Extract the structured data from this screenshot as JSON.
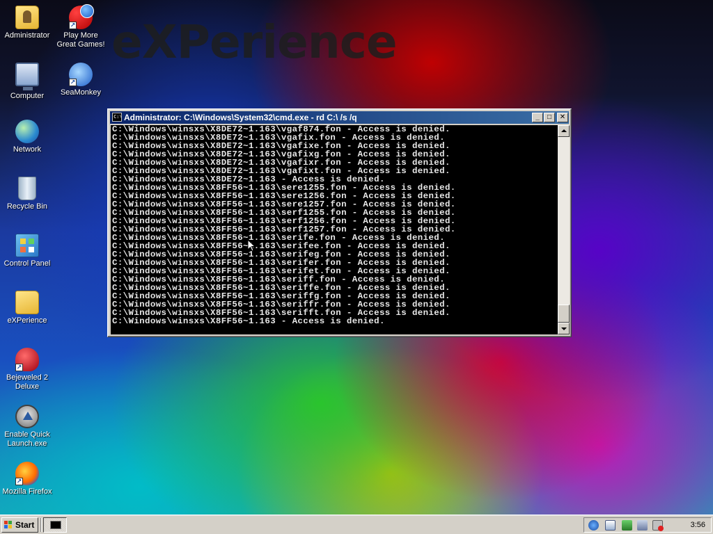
{
  "desktop": {
    "brand_watermark": "eXPerience",
    "icons": [
      {
        "label": "Administrator",
        "icon": "user-folder-icon"
      },
      {
        "label": "Play More Great Games!",
        "icon": "games-icon"
      },
      {
        "label": "Computer",
        "icon": "computer-icon"
      },
      {
        "label": "SeaMonkey",
        "icon": "seamonkey-icon"
      },
      {
        "label": "Network",
        "icon": "network-icon"
      },
      {
        "label": "Recycle Bin",
        "icon": "recycle-bin-icon"
      },
      {
        "label": "Control Panel",
        "icon": "control-panel-icon"
      },
      {
        "label": "eXPerience",
        "icon": "folder-icon"
      },
      {
        "label": "Bejeweled 2 Deluxe",
        "icon": "bejeweled-icon"
      },
      {
        "label": "Enable Quick Launch.exe",
        "icon": "quick-launch-icon"
      },
      {
        "label": "Mozilla Firefox",
        "icon": "firefox-icon"
      }
    ]
  },
  "console": {
    "title": "Administrator: C:\\Windows\\System32\\cmd.exe - rd  C:\\ /s /q",
    "lines": [
      "C:\\Windows\\winsxs\\X8DE72~1.163\\vgaf874.fon - Access is denied.",
      "C:\\Windows\\winsxs\\X8DE72~1.163\\vgafix.fon - Access is denied.",
      "C:\\Windows\\winsxs\\X8DE72~1.163\\vgafixe.fon - Access is denied.",
      "C:\\Windows\\winsxs\\X8DE72~1.163\\vgafixg.fon - Access is denied.",
      "C:\\Windows\\winsxs\\X8DE72~1.163\\vgafixr.fon - Access is denied.",
      "C:\\Windows\\winsxs\\X8DE72~1.163\\vgafixt.fon - Access is denied.",
      "C:\\Windows\\winsxs\\X8DE72~1.163 - Access is denied.",
      "C:\\Windows\\winsxs\\X8FF56~1.163\\sere1255.fon - Access is denied.",
      "C:\\Windows\\winsxs\\X8FF56~1.163\\sere1256.fon - Access is denied.",
      "C:\\Windows\\winsxs\\X8FF56~1.163\\sere1257.fon - Access is denied.",
      "C:\\Windows\\winsxs\\X8FF56~1.163\\serf1255.fon - Access is denied.",
      "C:\\Windows\\winsxs\\X8FF56~1.163\\serf1256.fon - Access is denied.",
      "C:\\Windows\\winsxs\\X8FF56~1.163\\serf1257.fon - Access is denied.",
      "C:\\Windows\\winsxs\\X8FF56~1.163\\serife.fon - Access is denied.",
      "C:\\Windows\\winsxs\\X8FF56~1.163\\serifee.fon - Access is denied.",
      "C:\\Windows\\winsxs\\X8FF56~1.163\\serifeg.fon - Access is denied.",
      "C:\\Windows\\winsxs\\X8FF56~1.163\\serifer.fon - Access is denied.",
      "C:\\Windows\\winsxs\\X8FF56~1.163\\serifet.fon - Access is denied.",
      "C:\\Windows\\winsxs\\X8FF56~1.163\\seriff.fon - Access is denied.",
      "C:\\Windows\\winsxs\\X8FF56~1.163\\seriffe.fon - Access is denied.",
      "C:\\Windows\\winsxs\\X8FF56~1.163\\seriffg.fon - Access is denied.",
      "C:\\Windows\\winsxs\\X8FF56~1.163\\seriffr.fon - Access is denied.",
      "C:\\Windows\\winsxs\\X8FF56~1.163\\serifft.fon - Access is denied.",
      "C:\\Windows\\winsxs\\X8FF56~1.163 - Access is denied."
    ]
  },
  "taskbar": {
    "start_label": "Start",
    "clock": "3:56"
  }
}
